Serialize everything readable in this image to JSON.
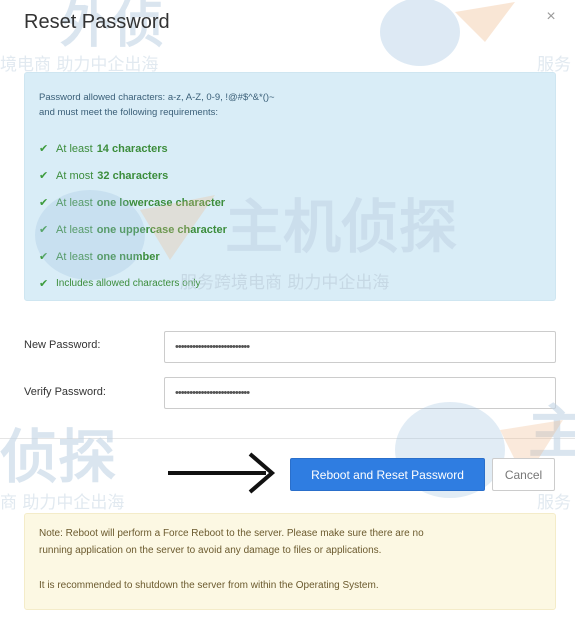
{
  "dialog": {
    "title": "Reset Password",
    "close_glyph": "×"
  },
  "requirements_box": {
    "line1": "Password allowed characters: a-z, A-Z, 0-9, !@#$^&*()~",
    "line2": "and must meet the following requirements:",
    "items": [
      {
        "pre": "At least",
        "strong": "14 characters",
        "post": ""
      },
      {
        "pre": "At most",
        "strong": "32 characters",
        "post": ""
      },
      {
        "pre": "At least",
        "strong": "one lowercase character",
        "post": ""
      },
      {
        "pre": "At least",
        "strong": "one uppercase character",
        "post": ""
      },
      {
        "pre": "At least",
        "strong": "one number",
        "post": ""
      },
      {
        "pre": "",
        "strong": "",
        "post": "Includes allowed characters only"
      }
    ],
    "check_icon": "check-icon",
    "check_color": "#3c9b3c"
  },
  "form": {
    "new_password_label": "New Password:",
    "new_password_value": "••••••••••••••••••••••••••",
    "verify_password_label": "Verify Password:",
    "verify_password_value": "••••••••••••••••••••••••••"
  },
  "actions": {
    "primary_label": "Reboot and Reset Password",
    "cancel_label": "Cancel",
    "arrow_icon": "right-arrow-icon",
    "primary_color": "#2f7de1"
  },
  "warning": {
    "line1": "Note: Reboot will perform a Force Reboot to the server. Please make sure there are no",
    "line2": "running application on the server to avoid any damage to files or applications.",
    "line3": "It is recommended to shutdown the server from within the Operating System."
  },
  "watermark": {
    "text_small_1": "境电商 助力中企出海",
    "text_small_2": "服务",
    "text_small_3": "服务跨境电商 助力中企出海",
    "text_small_4": "商 助力中企出海",
    "text_small_5": "服务",
    "text_big_1": "主机侦探",
    "text_big_2": "侦探",
    "text_big_3": "主",
    "text_big_4": "外侦"
  }
}
